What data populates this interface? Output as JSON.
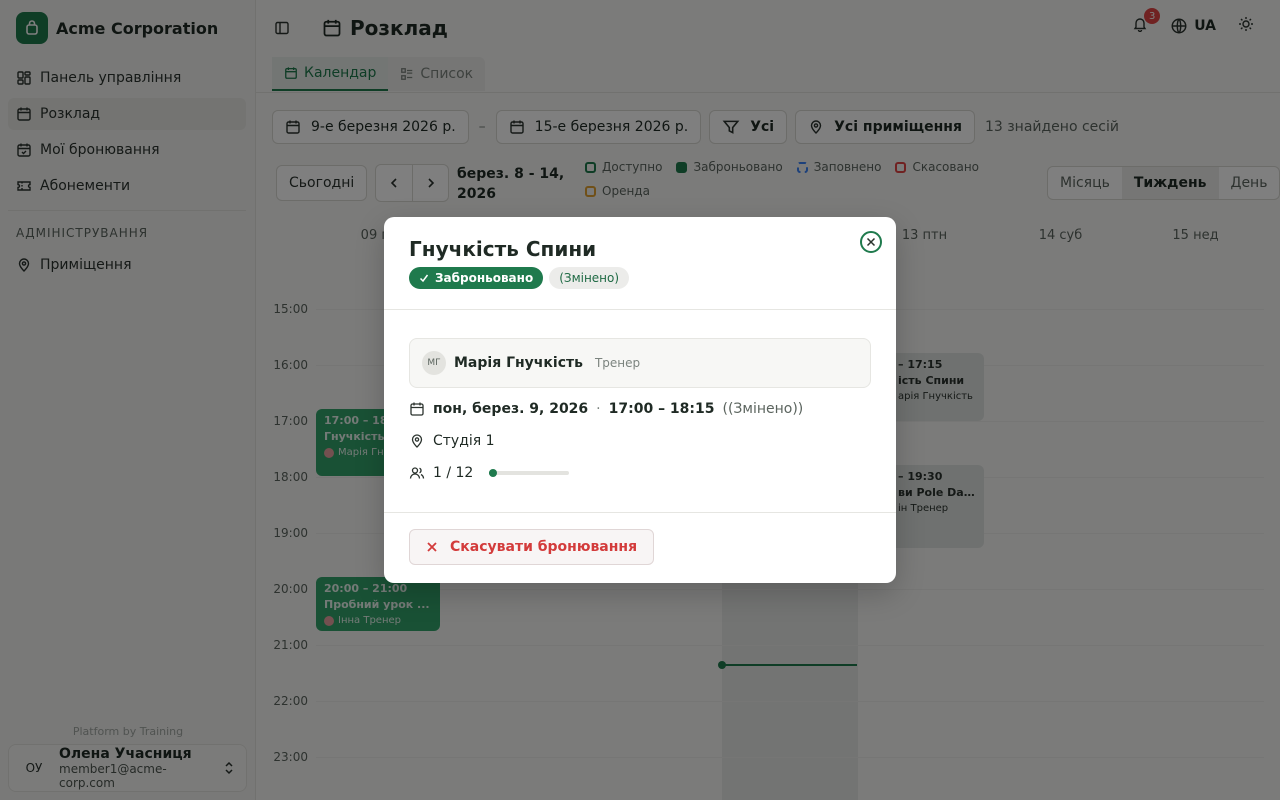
{
  "brand": {
    "name": "Acme Corporation"
  },
  "sidebar": {
    "items": [
      {
        "label": "Панель управління",
        "icon": "dashboard-icon"
      },
      {
        "label": "Розклад",
        "icon": "calendar-icon",
        "active": true
      },
      {
        "label": "Мої бронювання",
        "icon": "bookings-icon"
      },
      {
        "label": "Абонементи",
        "icon": "ticket-icon"
      }
    ],
    "admin_section": "АДМІНІСТРУВАННЯ",
    "admin_items": [
      {
        "label": "Приміщення",
        "icon": "location-icon"
      }
    ],
    "powered_by": "Platform by Training",
    "user": {
      "initials": "ОУ",
      "name": "Олена Учасниця",
      "email": "member1@acme-corp.com"
    }
  },
  "header": {
    "title": "Розклад",
    "notifications": "3",
    "language": "UA"
  },
  "tabs": {
    "calendar": "Календар",
    "list": "Список"
  },
  "filters": {
    "date_from": "9-е березня 2026 р.",
    "date_to": "15-е березня 2026 р.",
    "dash": "–",
    "type": "Усі",
    "rooms": "Усі приміщення",
    "count": "13 знайдено сесій"
  },
  "calendar": {
    "today": "Сьогодні",
    "range_label": "берез. 8 - 14, 2026",
    "legend": [
      {
        "label": "Доступно",
        "color": "#1f7a4d"
      },
      {
        "label": "Заброньовано",
        "color": "#1f7a4d",
        "filled": true
      },
      {
        "label": "Заповнено",
        "color": "#3b82f6"
      },
      {
        "label": "Скасовано",
        "color": "#e04545"
      },
      {
        "label": "Оренда",
        "color": "#e0a030"
      }
    ],
    "views": {
      "month": "Місяць",
      "week": "Тиждень",
      "day": "День"
    },
    "days": [
      {
        "label": "09 пон"
      },
      {
        "label": ""
      },
      {
        "label": ""
      },
      {
        "label": ""
      },
      {
        "label": "13 птн"
      },
      {
        "label": "14 суб"
      },
      {
        "label": "15 нед"
      }
    ],
    "hours": [
      "15:00",
      "16:00",
      "17:00",
      "18:00",
      "19:00",
      "20:00",
      "21:00",
      "22:00",
      "23:00"
    ],
    "events": [
      {
        "time": "17:00 – 18:15",
        "title": "Гнучкість Спини",
        "coach": "Марія Гнучкість",
        "style": "green"
      },
      {
        "time": "20:00 – 21:00",
        "title": "Пробний урок ...",
        "coach": "Інна Тренер",
        "style": "green"
      },
      {
        "time": "– 17:15",
        "title": "ість Спини",
        "coach": "арія Гнучкість",
        "style": "gray"
      },
      {
        "time": "– 19:30",
        "title": "ви Pole Dan...",
        "coach": "ін Тренер",
        "style": "gray"
      }
    ]
  },
  "modal": {
    "title": "Гнучкість Спини",
    "status": "Заброньовано",
    "changed": "(Змінено)",
    "trainer": {
      "initials": "МГ",
      "name": "Марія Гнучкість",
      "role": "Тренер"
    },
    "date": "пон, берез. 9, 2026",
    "dot": "·",
    "time": "17:00 – 18:15",
    "time_changed": "((Змінено))",
    "room": "Студія 1",
    "capacity": "1 / 12",
    "capacity_fraction": 0.083,
    "cancel": "Скасувати бронювання"
  }
}
